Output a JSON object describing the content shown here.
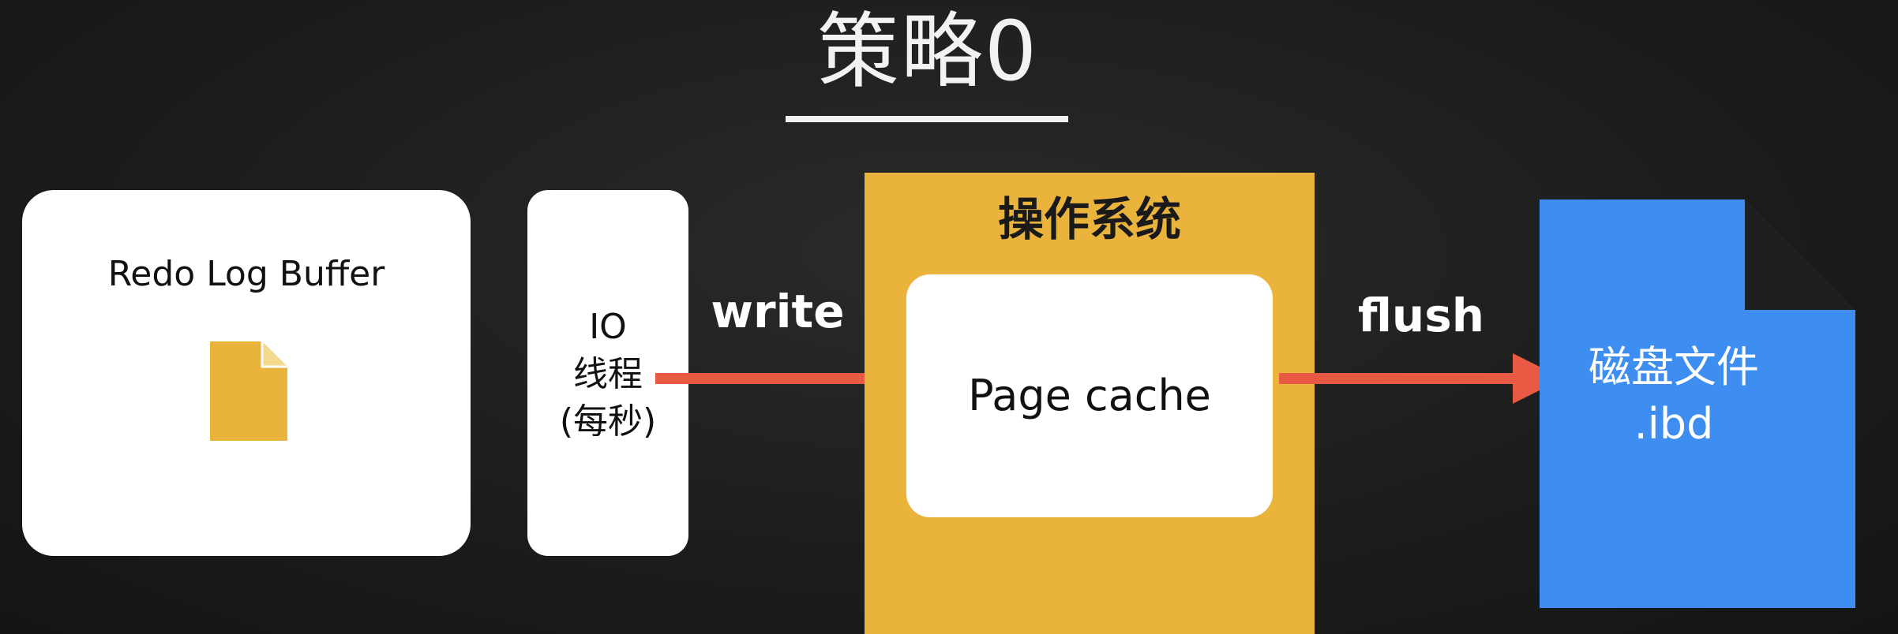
{
  "title": "策略0",
  "redo_log_buffer": {
    "label": "Redo Log Buffer",
    "icon": "document-icon"
  },
  "io_thread": {
    "line1": "IO",
    "line2": "线程",
    "line3": "(每秒)"
  },
  "arrows": {
    "write_label": "write",
    "flush_label": "flush"
  },
  "operating_system": {
    "title": "操作系统",
    "page_cache_label": "Page cache"
  },
  "disk_file": {
    "line1": "磁盘文件",
    "line2": ".ibd",
    "icon": "file-icon"
  },
  "colors": {
    "background": "#1c1c1c",
    "os_yellow": "#eab33c",
    "doc_yellow": "#eab33c",
    "arrow_red": "#e85a43",
    "disk_blue": "#3d8ef0",
    "disk_fold_dark": "#1f1f1f"
  }
}
